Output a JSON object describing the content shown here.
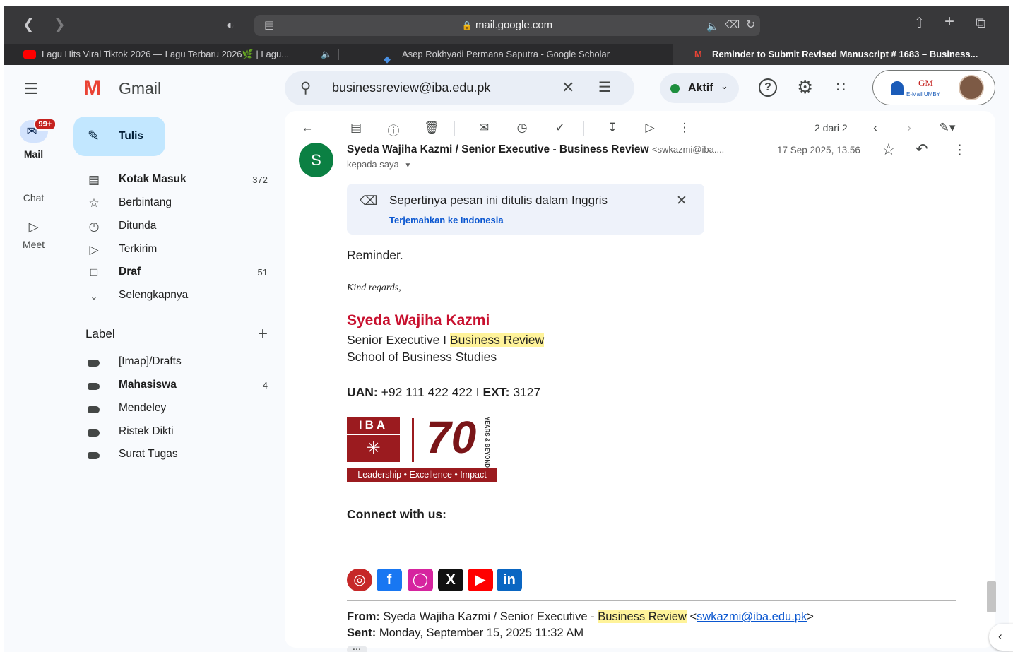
{
  "browser": {
    "url": "mail.google.com",
    "tabs": [
      {
        "title": "Lagu Hits Viral Tiktok 2026 — Lagu Terbaru 2026🌿 | Lagu..."
      },
      {
        "title": "Asep Rokhyadi Permana Saputra - Google Scholar"
      },
      {
        "title": "Reminder to Submit Revised Manuscript # 1683 – Business..."
      }
    ]
  },
  "app": {
    "brand": "Gmail",
    "rail": {
      "mail_badge": "99+",
      "mail_label": "Mail",
      "chat_label": "Chat",
      "meet_label": "Meet"
    },
    "compose_label": "Tulis",
    "nav": [
      {
        "label": "Kotak Masuk",
        "count": "372"
      },
      {
        "label": "Berbintang",
        "count": ""
      },
      {
        "label": "Ditunda",
        "count": ""
      },
      {
        "label": "Terkirim",
        "count": ""
      },
      {
        "label": "Draf",
        "count": "51"
      },
      {
        "label": "Selengkapnya",
        "count": ""
      }
    ],
    "labels_header": "Label",
    "labels": [
      {
        "label": "[Imap]/Drafts",
        "count": ""
      },
      {
        "label": "Mahasiswa",
        "count": "4"
      },
      {
        "label": "Mendeley",
        "count": ""
      },
      {
        "label": "Ristek Dikti",
        "count": ""
      },
      {
        "label": "Surat Tugas",
        "count": ""
      }
    ],
    "search_value": "businessreview@iba.edu.pk",
    "status_label": "Aktif",
    "account_brand": "GM",
    "account_sub": "E-Mail UMBY",
    "pagination": "2 dari 2"
  },
  "message": {
    "avatar_letter": "S",
    "sender_name": "Syeda Wajiha Kazmi / Senior Executive - Business Review",
    "sender_email": "<swkazmi@iba....",
    "date": "17 Sep 2025, 13.56",
    "to_line": "kepada saya",
    "translate_title": "Sepertinya pesan ini ditulis dalam Inggris",
    "translate_link": "Terjemahkan ke Indonesia",
    "body_first": "Reminder.",
    "regards": "Kind regards,",
    "sig_name": "Syeda Wajiha Kazmi",
    "sig_title_pre": "Senior Executive I ",
    "sig_title_hl": "Business Review",
    "sig_school": "School of Business Studies",
    "uan_label": "UAN:",
    "uan_value": "+92 111 422 422 I",
    "ext_label": "EXT:",
    "ext_value": "3127",
    "logo_iba": "IBA",
    "logo_70": "70",
    "logo_years": "YEARS & BEYOND",
    "logo_tagline": "Leadership • Excellence • Impact",
    "connect": "Connect with us:",
    "from_label": "From:",
    "from_pre": "Syeda Wajiha Kazmi / Senior Executive - ",
    "from_hl": "Business Review",
    "from_lt": "<",
    "from_email": "swkazmi@iba.edu.pk",
    "from_gt": ">",
    "sent_label": "Sent:",
    "sent_value": "Monday, September 15, 2025 11:32 AM"
  }
}
